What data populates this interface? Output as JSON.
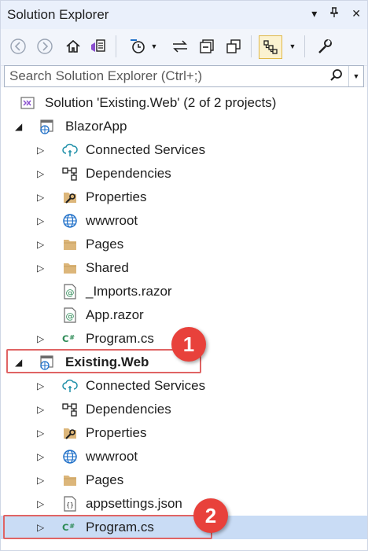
{
  "window": {
    "title": "Solution Explorer",
    "icons": [
      "dropdown-icon",
      "pin-icon",
      "close-icon"
    ]
  },
  "toolbar": {
    "buttons": [
      "back-icon",
      "forward-icon",
      "home-icon",
      "switch-views-icon",
      "pending-changes-filter-icon",
      "sync-with-document-icon",
      "collapse-all-icon",
      "show-all-files-icon",
      "preview-selected-items-icon",
      "properties-icon"
    ]
  },
  "search": {
    "placeholder": "Search Solution Explorer (Ctrl+;)"
  },
  "tree": {
    "solution": "Solution 'Existing.Web' (2 of 2 projects)",
    "blazor_project": {
      "name": "BlazorApp",
      "items": [
        "Connected Services",
        "Dependencies",
        "Properties",
        "wwwroot",
        "Pages",
        "Shared",
        "_Imports.razor",
        "App.razor",
        "Program.cs"
      ]
    },
    "existing_project": {
      "name": "Existing.Web",
      "items": [
        "Connected Services",
        "Dependencies",
        "Properties",
        "wwwroot",
        "Pages",
        "appsettings.json",
        "Program.cs"
      ]
    }
  },
  "annotations": {
    "badge_1": "1",
    "badge_2": "2"
  },
  "colors": {
    "selection": "#c9dcf5",
    "highlight_border": "#e06464",
    "badge": "#e8413b",
    "folder": "#dcb67a",
    "globe": "#1e6fc8",
    "csharp": "#2e8b57"
  }
}
